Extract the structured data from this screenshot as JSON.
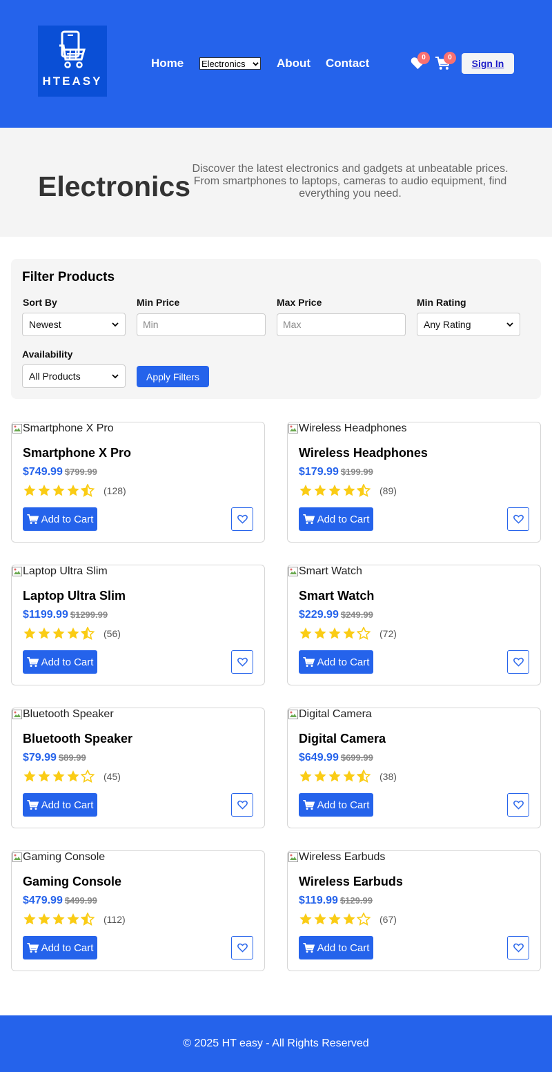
{
  "brand": {
    "logo_text": "HTEASY"
  },
  "nav": {
    "home": "Home",
    "category_select": "Electronics",
    "about": "About",
    "contact": "Contact",
    "wishlist_count": "0",
    "cart_count": "0",
    "sign_in": "Sign In"
  },
  "hero": {
    "title": "Electronics",
    "description": "Discover the latest electronics and gadgets at unbeatable prices. From smartphones to laptops, cameras to audio equipment, find everything you need."
  },
  "filters": {
    "title": "Filter Products",
    "sort_label": "Sort By",
    "sort_value": "Newest",
    "min_price_label": "Min Price",
    "min_price_placeholder": "Min",
    "max_price_label": "Max Price",
    "max_price_placeholder": "Max",
    "rating_label": "Min Rating",
    "rating_value": "Any Rating",
    "availability_label": "Availability",
    "availability_value": "All Products",
    "apply_label": "Apply Filters"
  },
  "products": [
    {
      "name": "Smartphone X Pro",
      "price": "$749.99",
      "old_price": "$799.99",
      "rating": 4.5,
      "reviews": "(128)"
    },
    {
      "name": "Wireless Headphones",
      "price": "$179.99",
      "old_price": "$199.99",
      "rating": 4.5,
      "reviews": "(89)"
    },
    {
      "name": "Laptop Ultra Slim",
      "price": "$1199.99",
      "old_price": "$1299.99",
      "rating": 4.5,
      "reviews": "(56)"
    },
    {
      "name": "Smart Watch",
      "price": "$229.99",
      "old_price": "$249.99",
      "rating": 4,
      "reviews": "(72)"
    },
    {
      "name": "Bluetooth Speaker",
      "price": "$79.99",
      "old_price": "$89.99",
      "rating": 4,
      "reviews": "(45)"
    },
    {
      "name": "Digital Camera",
      "price": "$649.99",
      "old_price": "$699.99",
      "rating": 4.5,
      "reviews": "(38)"
    },
    {
      "name": "Gaming Console",
      "price": "$479.99",
      "old_price": "$499.99",
      "rating": 4.5,
      "reviews": "(112)"
    },
    {
      "name": "Wireless Earbuds",
      "price": "$119.99",
      "old_price": "$129.99",
      "rating": 4,
      "reviews": "(67)"
    }
  ],
  "card_labels": {
    "add_to_cart": "Add to Cart"
  },
  "footer": {
    "text": "© 2025 HT easy - All Rights Reserved"
  },
  "colors": {
    "primary": "#2563eb",
    "star": "#facc15",
    "badge": "#f87171"
  }
}
